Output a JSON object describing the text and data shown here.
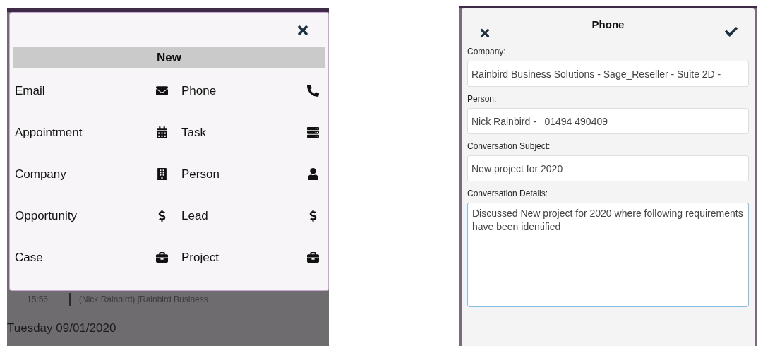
{
  "new_menu": {
    "title": "New",
    "items": [
      {
        "label": "Email",
        "kind": "email"
      },
      {
        "label": "Phone",
        "kind": "phone"
      },
      {
        "label": "Appointment",
        "kind": "calendar"
      },
      {
        "label": "Task",
        "kind": "task"
      },
      {
        "label": "Company",
        "kind": "building"
      },
      {
        "label": "Person",
        "kind": "person"
      },
      {
        "label": "Opportunity",
        "kind": "dollar"
      },
      {
        "label": "Lead",
        "kind": "dollar"
      },
      {
        "label": "Case",
        "kind": "briefcase"
      },
      {
        "label": "Project",
        "kind": "briefcase"
      }
    ]
  },
  "background": {
    "entry_time": "15:56",
    "entry_text": "(Nick Rainbird) [Rainbird Business",
    "date_heading": "Tuesday 09/01/2020"
  },
  "phone_form": {
    "title": "Phone",
    "fields": [
      {
        "label": "Company:",
        "value": "Rainbird Business Solutions - Sage_Reseller - Suite 2D -",
        "kind": "input"
      },
      {
        "label": "Person:",
        "value": "Nick Rainbird -   01494 490409",
        "kind": "input"
      },
      {
        "label": "Conversation Subject:",
        "value": "New project for 2020",
        "kind": "input"
      },
      {
        "label": "Conversation Details:",
        "value": "Discussed New project for 2020 where following requirements have been identified",
        "kind": "textarea"
      }
    ]
  }
}
